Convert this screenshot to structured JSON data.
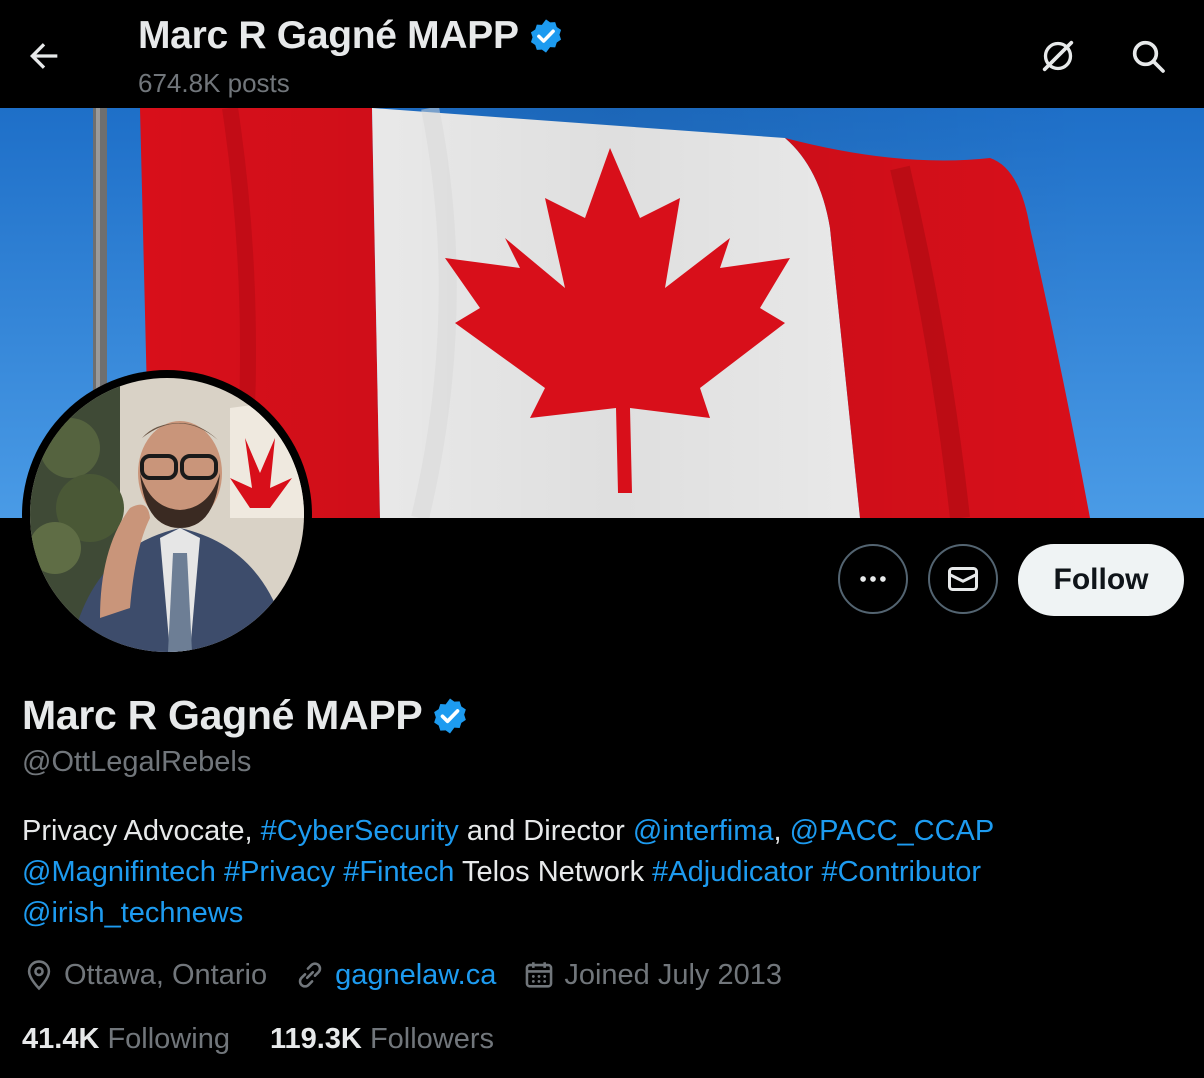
{
  "header": {
    "name": "Marc R Gagné MAPP",
    "posts": "674.8K posts",
    "back_icon": "arrow-left-icon",
    "grok_icon": "grok-icon",
    "search_icon": "search-icon"
  },
  "banner": {
    "description_icon": "canada-flag"
  },
  "actions": {
    "more_icon": "more-horizontal-icon",
    "message_icon": "envelope-icon",
    "follow_label": "Follow"
  },
  "profile": {
    "name": "Marc R Gagné MAPP",
    "handle": "@OttLegalRebels",
    "verified_color": "#1d9bf0",
    "bio": {
      "t1": "Privacy Advocate, ",
      "l1": "#CyberSecurity",
      "t2": " and Director ",
      "l2": "@interfima",
      "t3": ", ",
      "l3": "@PACC_CCAP",
      "l4": "@Magnifintech",
      "l5": "#Privacy",
      "l6": "#Fintech",
      "t4": " Telos Network ",
      "l7": "#Adjudicator",
      "l8": "#Contributor",
      "l9": "@irish_technews"
    },
    "location": "Ottawa, Ontario",
    "website": "gagnelaw.ca",
    "joined": "Joined July 2013",
    "following_count": "41.4K",
    "following_label": "Following",
    "followers_count": "119.3K",
    "followers_label": "Followers"
  },
  "colors": {
    "accent": "#1d9bf0",
    "muted": "#71767b",
    "text": "#e7e9ea"
  }
}
